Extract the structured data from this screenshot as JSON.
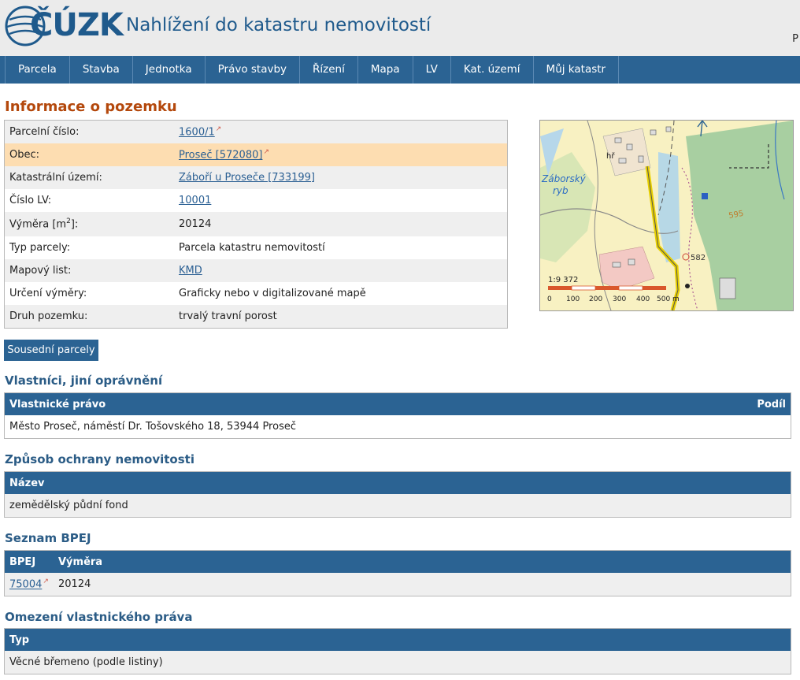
{
  "header": {
    "logo_text": "ČÚZK",
    "site_title": "Nahlížení do katastru nemovitostí",
    "corner_text": "P"
  },
  "nav": [
    "Parcela",
    "Stavba",
    "Jednotka",
    "Právo stavby",
    "Řízení",
    "Mapa",
    "LV",
    "Kat. území",
    "Můj katastr"
  ],
  "info": {
    "heading": "Informace o pozemku",
    "rows": {
      "parcel_number": {
        "label": "Parcelní číslo:",
        "value": "1600/1"
      },
      "municipality": {
        "label": "Obec:",
        "value": "Proseč [572080]"
      },
      "cadastral_area": {
        "label": "Katastrální území:",
        "value": "Záboří u Proseče [733199]"
      },
      "lv_number": {
        "label": "Číslo LV:",
        "value": "10001"
      },
      "area": {
        "label_main": "Výměra [m",
        "label_sup": "2",
        "label_end": "]:",
        "value": "20124"
      },
      "parcel_type": {
        "label": "Typ parcely:",
        "value": "Parcela katastru nemovitostí"
      },
      "map_sheet": {
        "label": "Mapový list:",
        "value": "KMD"
      },
      "area_determination": {
        "label": "Určení výměry:",
        "value": "Graficky nebo v digitalizované mapě"
      },
      "land_type": {
        "label": "Druh pozemku:",
        "value": "trvalý travní porost"
      }
    }
  },
  "map": {
    "labels": {
      "place": "hř",
      "pond_1": "Záborský",
      "pond_2": "ryb",
      "elevation": "582",
      "contour": "595",
      "scale": "1:9 372"
    },
    "scale_ticks": [
      "0",
      "100",
      "200",
      "300",
      "400",
      "500 m"
    ]
  },
  "neighbors_button": "Sousední parcely",
  "owners": {
    "heading": "Vlastníci, jiní oprávnění",
    "col_left": "Vlastnické právo",
    "col_right": "Podíl",
    "row": "Město Proseč, náměstí Dr. Tošovského 18, 53944 Proseč"
  },
  "protection": {
    "heading": "Způsob ochrany nemovitosti",
    "col": "Název",
    "row": "zemědělský půdní fond"
  },
  "bpej": {
    "heading": "Seznam BPEJ",
    "col_code": "BPEJ",
    "col_area": "Výměra",
    "code": "75004",
    "area": "20124"
  },
  "restrictions": {
    "heading": "Omezení vlastnického práva",
    "col": "Typ",
    "row": "Věcné břemeno (podle listiny)"
  }
}
